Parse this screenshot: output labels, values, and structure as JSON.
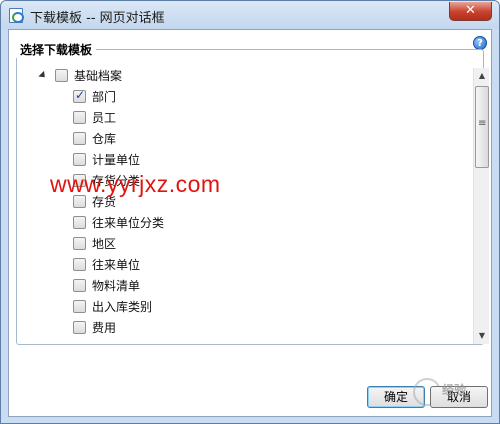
{
  "window": {
    "title": "下载模板 -- 网页对话框",
    "close_label": "✕"
  },
  "panel": {
    "legend": "选择下载模板",
    "help_icon_label": "?"
  },
  "tree": {
    "root": {
      "label": "基础档案",
      "checked": false,
      "expanded": true
    },
    "items": [
      {
        "label": "部门",
        "checked": true
      },
      {
        "label": "员工",
        "checked": false
      },
      {
        "label": "仓库",
        "checked": false
      },
      {
        "label": "计量单位",
        "checked": false
      },
      {
        "label": "存货分类",
        "checked": false
      },
      {
        "label": "存货",
        "checked": false
      },
      {
        "label": "往来单位分类",
        "checked": false
      },
      {
        "label": "地区",
        "checked": false
      },
      {
        "label": "往来单位",
        "checked": false
      },
      {
        "label": "物料清单",
        "checked": false
      },
      {
        "label": "出入库类别",
        "checked": false
      },
      {
        "label": "费用",
        "checked": false
      }
    ]
  },
  "scrollbar": {
    "up_icon": "up-arrow-icon",
    "down_icon": "down-arrow-icon"
  },
  "buttons": {
    "ok": "确定",
    "cancel": "取消"
  },
  "watermark": {
    "url": "www.yyrjxz.com",
    "logo_text": "经验"
  }
}
